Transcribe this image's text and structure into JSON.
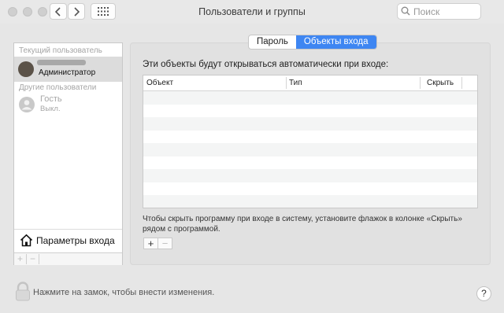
{
  "window": {
    "title": "Пользователи и группы"
  },
  "search": {
    "placeholder": "Поиск"
  },
  "sidebar": {
    "current_user_label": "Текущий пользователь",
    "current_user_role": "Администратор",
    "other_users_label": "Другие пользователи",
    "guest_name": "Гость",
    "guest_status": "Выкл.",
    "login_options_label": "Параметры входа",
    "add_symbol": "+",
    "remove_symbol": "−"
  },
  "tabs": [
    {
      "label": "Пароль",
      "active": false
    },
    {
      "label": "Объекты входа",
      "active": true
    }
  ],
  "main": {
    "heading": "Эти объекты будут открываться автоматически при входе:",
    "columns": [
      "Объект",
      "Тип",
      "Скрыть"
    ],
    "hint": "Чтобы скрыть программу при входе в систему, установите флажок в колонке «Скрыть» рядом с программой.",
    "add_symbol": "+",
    "remove_symbol": "−"
  },
  "footer": {
    "lock_text": "Нажмите на замок, чтобы внести изменения.",
    "help_symbol": "?"
  },
  "colors": {
    "accent": "#3e86f2",
    "selection": "#dcdcdc"
  }
}
